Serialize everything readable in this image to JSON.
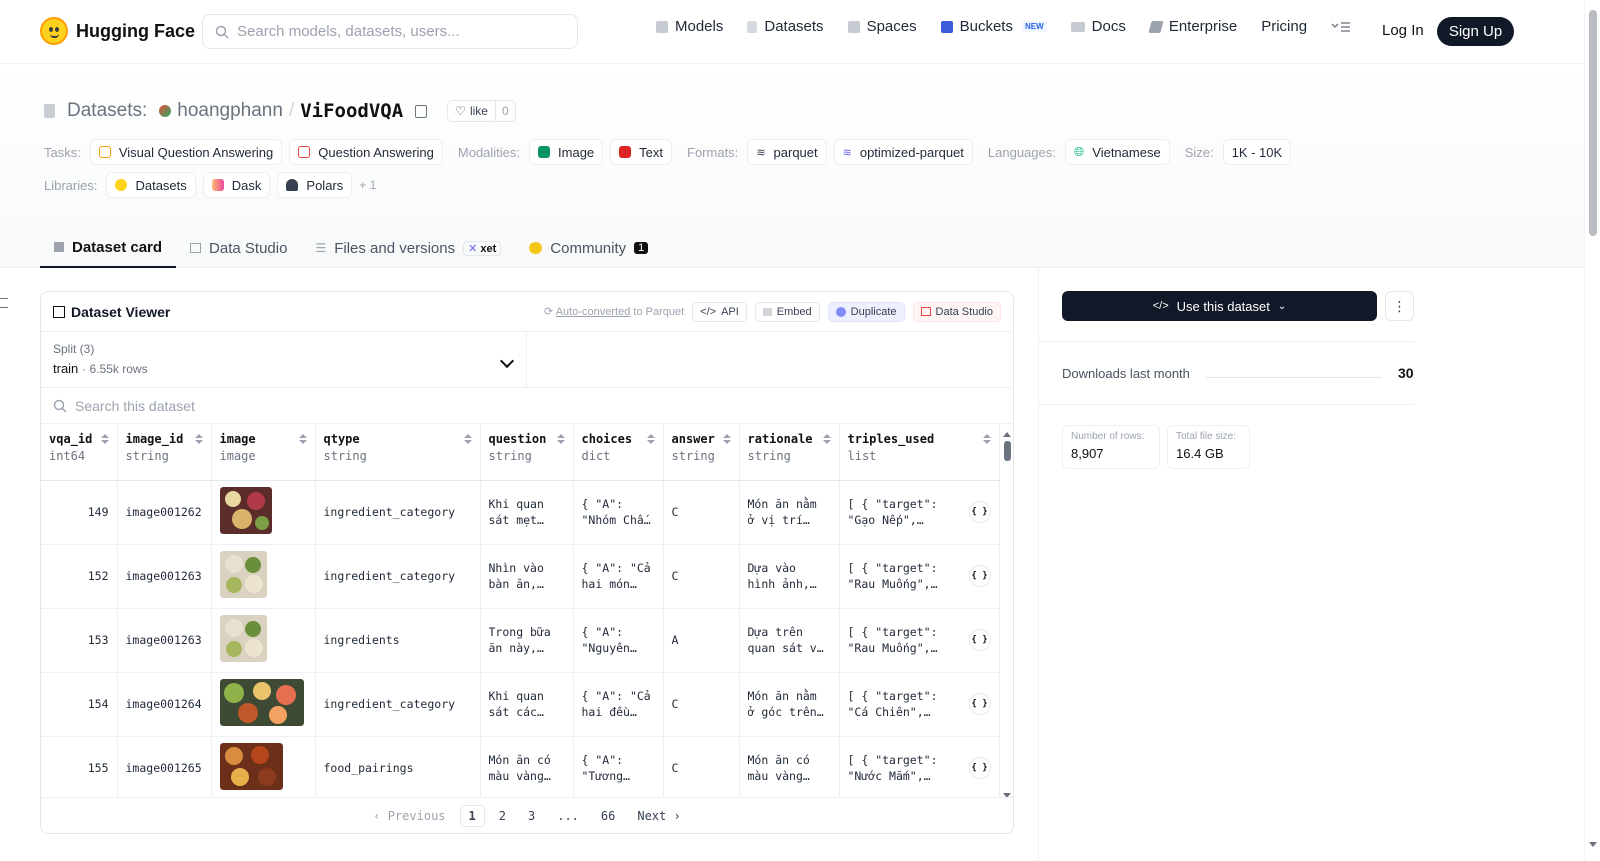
{
  "nav": {
    "logo_text": "Hugging Face",
    "search_placeholder": "Search models, datasets, users...",
    "links": {
      "models": "Models",
      "datasets": "Datasets",
      "spaces": "Spaces",
      "buckets": "Buckets",
      "buckets_badge": "NEW",
      "docs": "Docs",
      "enterprise": "Enterprise",
      "pricing": "Pricing"
    },
    "login": "Log In",
    "signup": "Sign Up"
  },
  "header": {
    "section_label": "Datasets:",
    "owner": "hoangphann",
    "separator": "/",
    "name": "ViFoodVQA",
    "like_label": "like",
    "like_count": "0"
  },
  "tags": {
    "tasks_label": "Tasks:",
    "tasks": [
      "Visual Question Answering",
      "Question Answering"
    ],
    "modalities_label": "Modalities:",
    "modalities": [
      "Image",
      "Text"
    ],
    "formats_label": "Formats:",
    "formats": [
      "parquet",
      "optimized-parquet"
    ],
    "languages_label": "Languages:",
    "languages": [
      "Vietnamese"
    ],
    "size_label": "Size:",
    "size": "1K - 10K",
    "libraries_label": "Libraries:",
    "libraries": [
      "Datasets",
      "Dask",
      "Polars"
    ],
    "libraries_more": "+ 1"
  },
  "tabs": {
    "card": "Dataset card",
    "studio": "Data Studio",
    "files": "Files and versions",
    "files_badge": "xet",
    "community": "Community",
    "community_count": "1"
  },
  "viewer": {
    "title": "Dataset Viewer",
    "auto_converted": "Auto-converted",
    "auto_converted_suffix": "to Parquet",
    "api": "API",
    "embed": "Embed",
    "duplicate": "Duplicate",
    "data_studio": "Data Studio",
    "split_label": "Split (3)",
    "split_name": "train",
    "split_dot": "·",
    "split_rows": "6.55k rows",
    "search_placeholder": "Search this dataset",
    "columns": [
      {
        "name": "vqa_id",
        "type": "int64"
      },
      {
        "name": "image_id",
        "type": "string"
      },
      {
        "name": "image",
        "type": "image"
      },
      {
        "name": "qtype",
        "type": "string"
      },
      {
        "name": "question",
        "type": "string"
      },
      {
        "name": "choices",
        "type": "dict"
      },
      {
        "name": "answer",
        "type": "string"
      },
      {
        "name": "rationale",
        "type": "string"
      },
      {
        "name": "triples_used",
        "type": "list"
      }
    ],
    "rows": [
      {
        "vqa_id": "149",
        "image_id": "image001262",
        "qtype": "ingredient_category",
        "question": "Khi quan sát mẹt…",
        "choices": "{ \"A\": \"Nhóm Chấ…",
        "answer": "C",
        "rationale": "Món ăn nằm ở vị trí…",
        "triples": "[ { \"target\": \"Gạo Nếp\",…",
        "json_btn": "{ }"
      },
      {
        "vqa_id": "152",
        "image_id": "image001263",
        "qtype": "ingredient_category",
        "question": "Nhìn vào bàn ăn,…",
        "choices": "{ \"A\": \"Cả hai món…",
        "answer": "C",
        "rationale": "Dựa vào hình ảnh,…",
        "triples": "[ { \"target\": \"Rau Muống\",…",
        "json_btn": "{ }"
      },
      {
        "vqa_id": "153",
        "image_id": "image001263",
        "qtype": "ingredients",
        "question": "Trong bữa ăn này,…",
        "choices": "{ \"A\": \"Nguyên…",
        "answer": "A",
        "rationale": "Dựa trên quan sát v…",
        "triples": "[ { \"target\": \"Rau Muống\",…",
        "json_btn": "{ }"
      },
      {
        "vqa_id": "154",
        "image_id": "image001264",
        "qtype": "ingredient_category",
        "question": "Khi quan sát các…",
        "choices": "{ \"A\": \"Cả hai đều…",
        "answer": "C",
        "rationale": "Món ăn nằm ở góc trên…",
        "triples": "[ { \"target\": \"Cá Chiên\",…",
        "json_btn": "{ }"
      },
      {
        "vqa_id": "155",
        "image_id": "image001265",
        "qtype": "food_pairings",
        "question": "Món ăn có màu vàng…",
        "choices": "{ \"A\": \"Tương…",
        "answer": "C",
        "rationale": "Món ăn có màu vàng…",
        "triples": "[ { \"target\": \"Nước Mắm\",…",
        "json_btn": "{ }"
      }
    ],
    "pager": {
      "previous": "Previous",
      "pages": [
        "1",
        "2",
        "3",
        "...",
        "66"
      ],
      "next": "Next"
    }
  },
  "sidebar": {
    "use_button": "Use this dataset",
    "downloads_label": "Downloads last month",
    "downloads_value": "30",
    "rows_label": "Number of rows:",
    "rows_value": "8,907",
    "size_label": "Total file size:",
    "size_value": "16.4 GB"
  },
  "colors": {
    "accent_dark": "#111827",
    "hf_yellow": "#ffd21e"
  }
}
